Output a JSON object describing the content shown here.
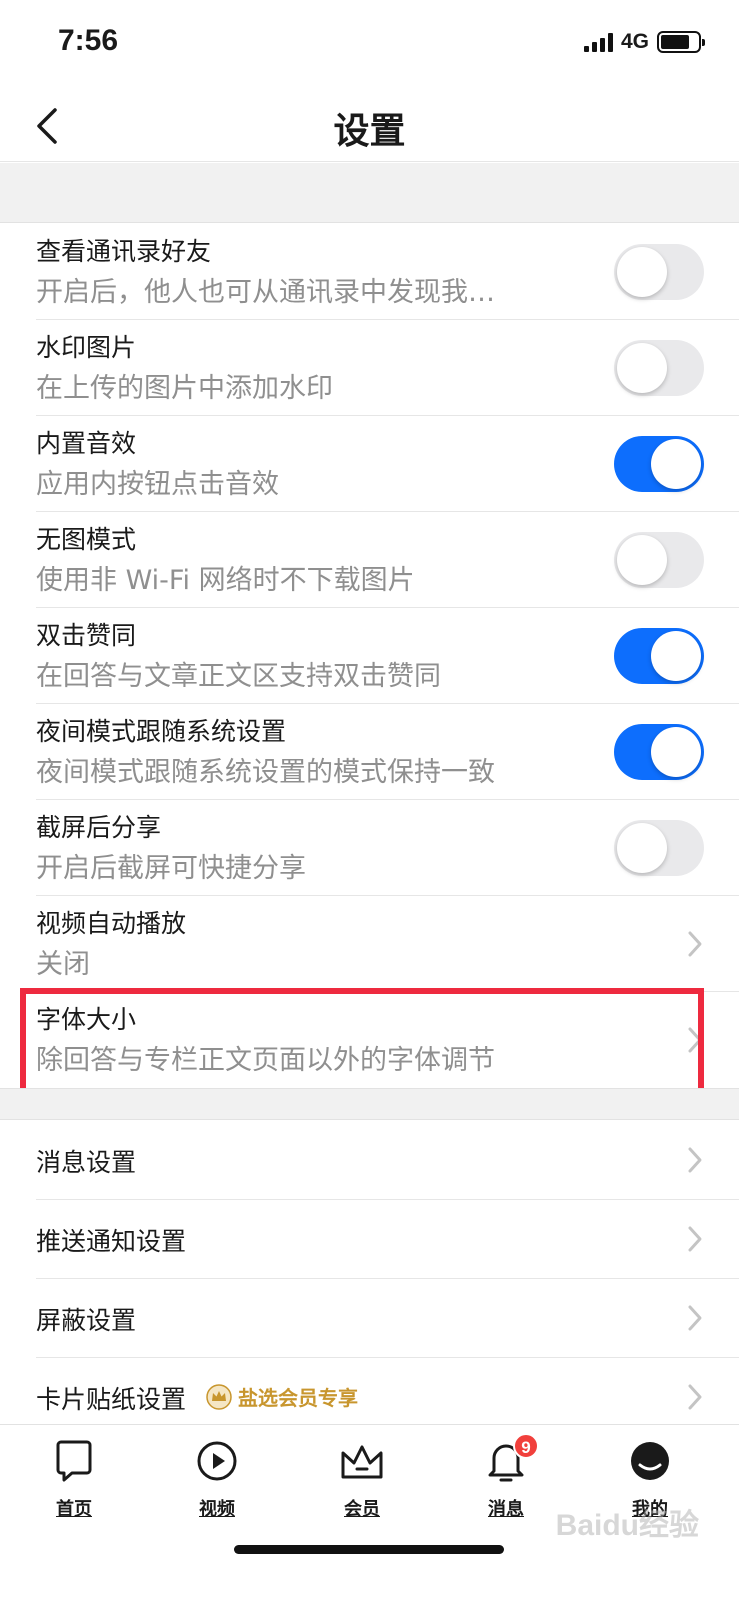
{
  "status": {
    "time": "7:56",
    "network": "4G",
    "battery_level": 0.8
  },
  "nav": {
    "title": "设置"
  },
  "settings": [
    {
      "title": "查看通讯录好友",
      "subtitle": "开启后，他人也可从通讯录中发现我…",
      "control": "toggle",
      "on": false
    },
    {
      "title": "水印图片",
      "subtitle": "在上传的图片中添加水印",
      "control": "toggle",
      "on": false
    },
    {
      "title": "内置音效",
      "subtitle": "应用内按钮点击音效",
      "control": "toggle",
      "on": true
    },
    {
      "title": "无图模式",
      "subtitle": "使用非 Wi-Fi 网络时不下载图片",
      "control": "toggle",
      "on": false
    },
    {
      "title": "双击赞同",
      "subtitle": "在回答与文章正文区支持双击赞同",
      "control": "toggle",
      "on": true
    },
    {
      "title": "夜间模式跟随系统设置",
      "subtitle": "夜间模式跟随系统设置的模式保持一致",
      "control": "toggle",
      "on": true
    },
    {
      "title": "截屏后分享",
      "subtitle": "开启后截屏可快捷分享",
      "control": "toggle",
      "on": false
    },
    {
      "title": "视频自动播放",
      "subtitle": "关闭",
      "control": "chevron"
    },
    {
      "title": "字体大小",
      "subtitle": "除回答与专栏正文页面以外的字体调节",
      "control": "chevron"
    }
  ],
  "settings2": [
    {
      "title": "消息设置"
    },
    {
      "title": "推送通知设置"
    },
    {
      "title": "屏蔽设置"
    },
    {
      "title": "卡片贴纸设置",
      "tag": "盐选会员专享"
    }
  ],
  "tabs": [
    {
      "label": "首页",
      "icon": "home-icon"
    },
    {
      "label": "视频",
      "icon": "video-icon"
    },
    {
      "label": "会员",
      "icon": "vip-icon"
    },
    {
      "label": "消息",
      "icon": "bell-icon",
      "badge": "9"
    },
    {
      "label": "我的",
      "icon": "profile-icon"
    }
  ],
  "watermark": "Baidu经验",
  "colors": {
    "toggle_on": "#0d6efd",
    "highlight": "#ee2a3f",
    "vip": "#c8962e",
    "badge": "#f1403c"
  }
}
